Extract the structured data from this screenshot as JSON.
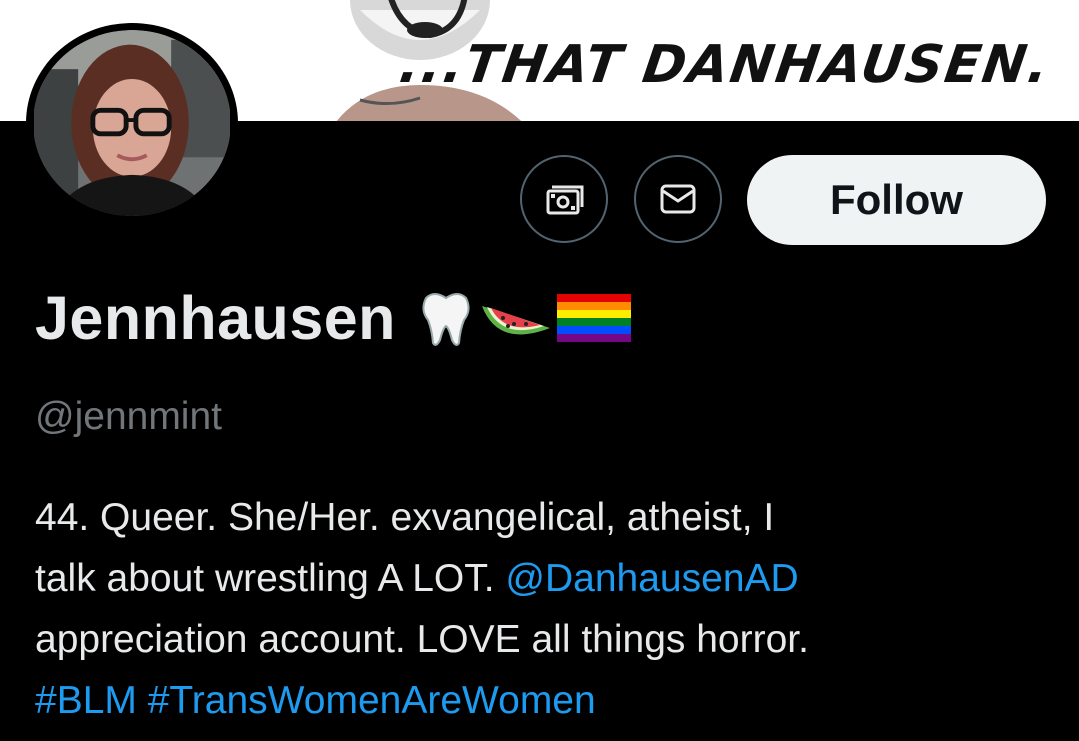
{
  "banner": {
    "text": "...THAT DANHAUSEN."
  },
  "avatar": {
    "icon": "profile-photo"
  },
  "actions": {
    "tip_icon": "money-icon",
    "message_icon": "envelope-icon",
    "follow_label": "Follow"
  },
  "profile": {
    "display_name": "Jennhausen",
    "name_emojis": [
      "tooth-icon",
      "watermelon-icon",
      "rainbow-flag-icon"
    ],
    "handle": "@jennmint",
    "bio": {
      "line1": "44. Queer. She/Her. exvangelical, atheist, I",
      "line2_text": "talk about wrestling A LOT. ",
      "line2_mention": "@DanhausenAD",
      "line3": "appreciation account. LOVE all things horror.",
      "hashtag1": "#BLM",
      "hashtag2": "#TransWomenAreWomen"
    }
  },
  "colors": {
    "background": "#000000",
    "text": "#e7e9ea",
    "secondary_text": "#71767b",
    "link": "#1d9bf0",
    "follow_bg": "#eff3f4",
    "button_border": "#536471"
  }
}
